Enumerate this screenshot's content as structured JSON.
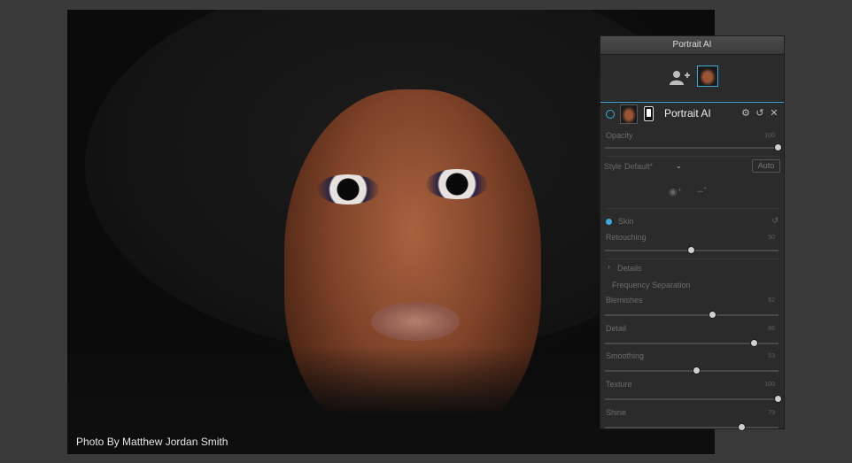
{
  "photo": {
    "credit": "Photo By Matthew Jordan Smith"
  },
  "panel": {
    "title": "Portrait AI",
    "filter": {
      "name": "Portrait AI",
      "opacity": {
        "label": "Opacity",
        "value": "100",
        "level": 100
      },
      "style": {
        "label": "Style",
        "value": "Default*",
        "auto_label": "Auto"
      },
      "skin": {
        "label": "Skin",
        "retouching": {
          "label": "Retouching",
          "value": "50",
          "level": 50
        },
        "details_label": "Details",
        "freq_sep_label": "Frequency Separation",
        "sliders": [
          {
            "label": "Blemishes",
            "value": "62",
            "level": 62
          },
          {
            "label": "Detail",
            "value": "86",
            "level": 86
          },
          {
            "label": "Smoothing",
            "value": "53",
            "level": 53
          },
          {
            "label": "Texture",
            "value": "100",
            "level": 100
          },
          {
            "label": "Shine",
            "value": "79",
            "level": 79
          }
        ]
      }
    }
  },
  "colors": {
    "accent": "#3fa9d8",
    "panel_bg": "#2b2b2b"
  }
}
